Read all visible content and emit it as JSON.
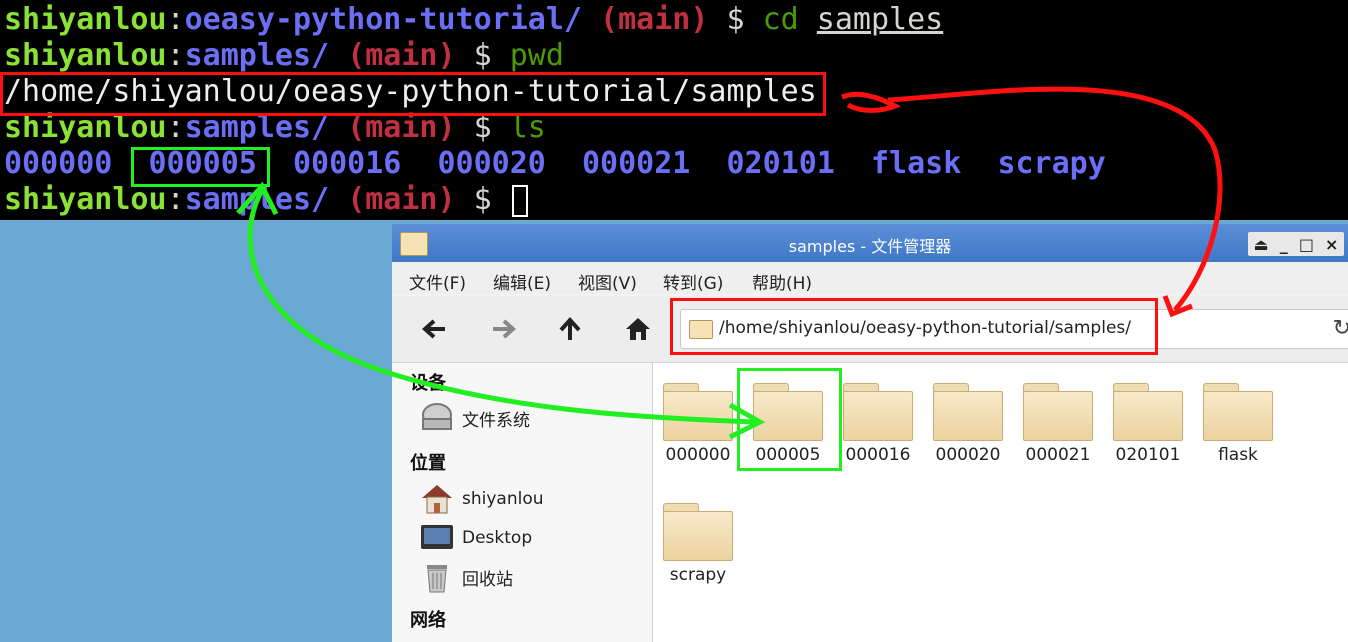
{
  "terminal": {
    "user": "shiyanlou",
    "colon": ":",
    "branch": "(main)",
    "prompt": "$",
    "lines": [
      {
        "path": "oeasy-python-tutorial/",
        "cmd": "cd",
        "arg": "samples"
      },
      {
        "path": "samples/",
        "cmd": "pwd"
      },
      {
        "output": "/home/shiyanlou/oeasy-python-tutorial/samples"
      },
      {
        "path": "samples/",
        "cmd": "ls"
      },
      {
        "listing": [
          "000000",
          "000005",
          "000016",
          "000020",
          "000021",
          "020101",
          "flask",
          "scrapy"
        ]
      },
      {
        "path": "samples/"
      }
    ]
  },
  "file_manager": {
    "title": "samples - 文件管理器",
    "window_controls": [
      "⏏",
      "_",
      "□",
      "×"
    ],
    "menu": [
      "文件(F)",
      "编辑(E)",
      "视图(V)",
      "转到(G)",
      "帮助(H)"
    ],
    "address": "/home/shiyanlou/oeasy-python-tutorial/samples/",
    "sidebar": {
      "devices_heading": "设备",
      "filesystem": "文件系统",
      "places_heading": "位置",
      "home": "shiyanlou",
      "desktop": "Desktop",
      "trash": "回收站",
      "network_heading": "网络"
    },
    "folders": [
      "000000",
      "000005",
      "000016",
      "000020",
      "000021",
      "020101",
      "flask",
      "scrapy"
    ]
  },
  "colors": {
    "highlight_red": "#ff1010",
    "highlight_green": "#22ee22",
    "term_user": "#8ae234",
    "term_path": "#6a6ff5",
    "term_branch": "#c03040"
  }
}
